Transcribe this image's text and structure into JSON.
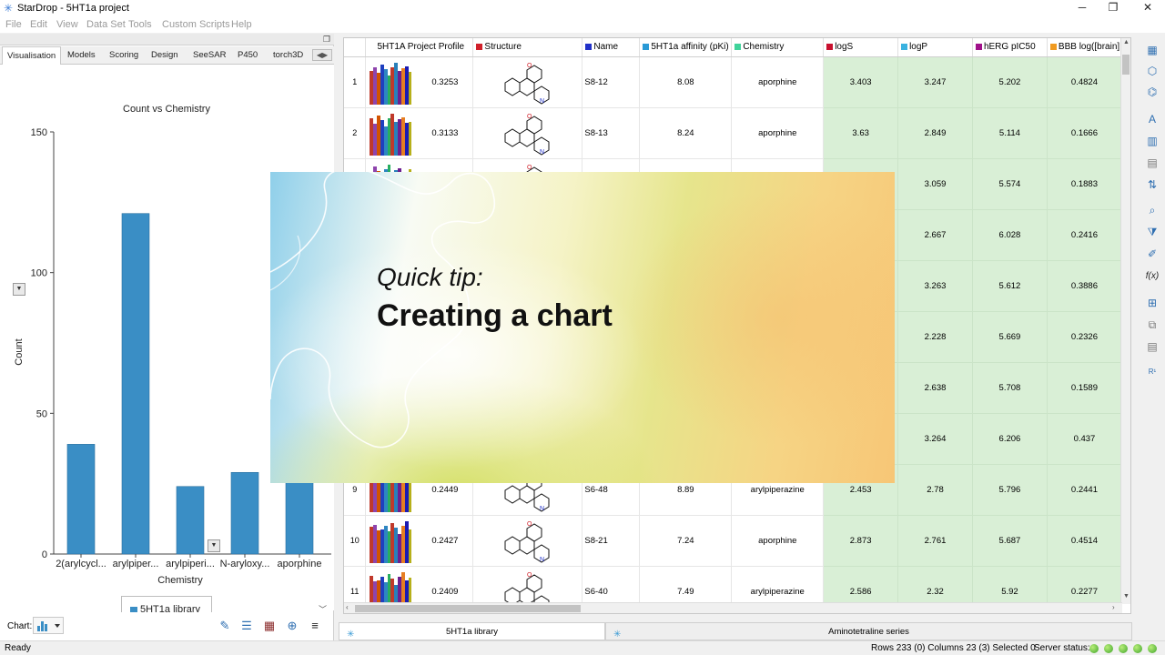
{
  "window": {
    "title": "StarDrop - 5HT1a project",
    "minimize": "─",
    "restore": "❐",
    "close": "✕"
  },
  "menu": [
    "File",
    "Edit",
    "View",
    "Data Set",
    "Tools",
    "Custom Scripts",
    "Help"
  ],
  "left_panel": {
    "tabs": [
      "Visualisation",
      "Models",
      "Scoring",
      "Design",
      "SeeSAR",
      "P450",
      "torch3D"
    ],
    "active_tab": "Visualisation",
    "chart_label": "Chart:",
    "legend": "5HT1a library"
  },
  "chart_data": {
    "type": "bar",
    "title": "Count vs Chemistry",
    "xlabel": "Chemistry",
    "ylabel": "Count",
    "categories": [
      "2(arylcycl...",
      "arylpiper...",
      "arylpiperi...",
      "N-aryloxy...",
      "aporphine"
    ],
    "values": [
      39,
      121,
      24,
      29,
      27
    ],
    "ylim": [
      0,
      150
    ],
    "yticks": [
      0,
      50,
      100,
      150
    ],
    "series": [
      {
        "name": "5HT1a library",
        "values": [
          39,
          121,
          24,
          29,
          27
        ]
      }
    ],
    "color": "#3a8ec5",
    "grid": false,
    "legend_position": "bottom"
  },
  "table": {
    "columns": [
      {
        "label": "",
        "color": ""
      },
      {
        "label": "5HT1A Project Profile",
        "color": ""
      },
      {
        "label": "Structure",
        "color": "#d0202a"
      },
      {
        "label": "Name",
        "color": "#2030c8"
      },
      {
        "label": "5HT1a affinity (pKi)",
        "color": "#2a9ad6"
      },
      {
        "label": "Chemistry",
        "color": "#3fd39a"
      },
      {
        "label": "logS",
        "color": "#c8102e"
      },
      {
        "label": "logP",
        "color": "#3ab2e0"
      },
      {
        "label": "hERG pIC50",
        "color": "#a0108a"
      },
      {
        "label": "BBB log([brain]",
        "color": "#f09a20"
      }
    ],
    "rows": [
      {
        "num": "1",
        "profile": "0.3253",
        "name": "S8-12",
        "affinity": "8.08",
        "chemistry": "aporphine",
        "logS": "3.403",
        "logP": "3.247",
        "herg": "5.202",
        "bbb": "0.4824"
      },
      {
        "num": "2",
        "profile": "0.3133",
        "name": "S8-13",
        "affinity": "8.24",
        "chemistry": "aporphine",
        "logS": "3.63",
        "logP": "2.849",
        "herg": "5.114",
        "bbb": "0.1666"
      },
      {
        "num": "3",
        "profile": "",
        "name": "",
        "affinity": "",
        "chemistry": "",
        "logS": "",
        "logP": "3.059",
        "herg": "5.574",
        "bbb": "0.1883"
      },
      {
        "num": "4",
        "profile": "",
        "name": "",
        "affinity": "",
        "chemistry": "",
        "logS": "",
        "logP": "2.667",
        "herg": "6.028",
        "bbb": "0.2416"
      },
      {
        "num": "5",
        "profile": "",
        "name": "",
        "affinity": "",
        "chemistry": "",
        "logS": "",
        "logP": "3.263",
        "herg": "5.612",
        "bbb": "0.3886"
      },
      {
        "num": "6",
        "profile": "",
        "name": "",
        "affinity": "",
        "chemistry": "",
        "logS": "",
        "logP": "2.228",
        "herg": "5.669",
        "bbb": "0.2326"
      },
      {
        "num": "7",
        "profile": "",
        "name": "",
        "affinity": "",
        "chemistry": "",
        "logS": "",
        "logP": "2.638",
        "herg": "5.708",
        "bbb": "0.1589"
      },
      {
        "num": "8",
        "profile": "",
        "name": "",
        "affinity": "",
        "chemistry": "",
        "logS": "",
        "logP": "3.264",
        "herg": "6.206",
        "bbb": "0.437"
      },
      {
        "num": "9",
        "profile": "0.2449",
        "name": "S6-48",
        "affinity": "8.89",
        "chemistry": "arylpiperazine",
        "logS": "2.453",
        "logP": "2.78",
        "herg": "5.796",
        "bbb": "0.2441"
      },
      {
        "num": "10",
        "profile": "0.2427",
        "name": "S8-21",
        "affinity": "7.24",
        "chemistry": "aporphine",
        "logS": "2.873",
        "logP": "2.761",
        "herg": "5.687",
        "bbb": "0.4514"
      },
      {
        "num": "11",
        "profile": "0.2409",
        "name": "S6-40",
        "affinity": "7.49",
        "chemistry": "arylpiperazine",
        "logS": "2.586",
        "logP": "2.32",
        "herg": "5.92",
        "bbb": "0.2277"
      }
    ]
  },
  "profile_colors": [
    "#c0392b",
    "#8e44ad",
    "#d35400",
    "#1f3fbf",
    "#2e86c1",
    "#27ae60",
    "#c0392b",
    "#2980b9",
    "#6c1f8f",
    "#e67e22",
    "#1b1bb3",
    "#b7b01a"
  ],
  "bottom_tabs": [
    "5HT1a library",
    "Aminotetraline series"
  ],
  "status": {
    "left": "Ready",
    "info": "Rows 233 (0) Columns 23 (3) Selected 0",
    "server": "Server status:"
  },
  "overlay": {
    "line1": "Quick tip:",
    "line2": "Creating a chart"
  }
}
